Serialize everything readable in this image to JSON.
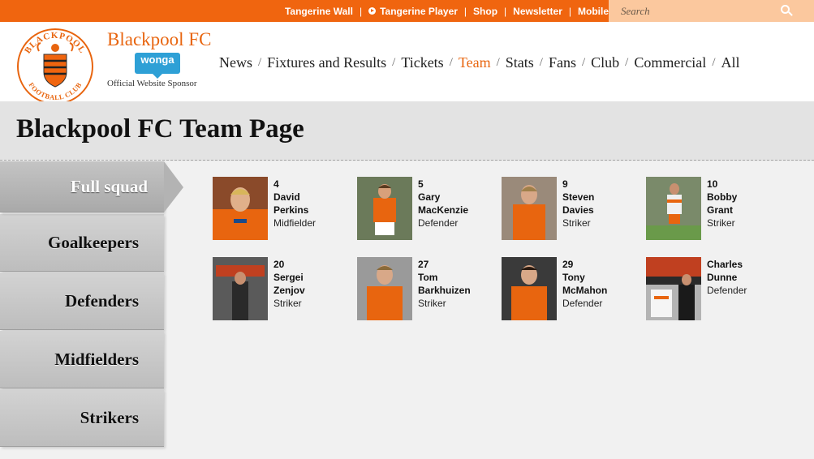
{
  "topbar": {
    "links": [
      "Tangerine Wall",
      "Tangerine Player",
      "Shop",
      "Newsletter",
      "Mobile"
    ],
    "search_placeholder": "Search"
  },
  "header": {
    "club_name": "Blackpool FC",
    "sponsor_logo_text": "wonga",
    "sponsor_text": "Official Website Sponsor",
    "crest_text_top": "BLACKPOOL",
    "crest_text_bottom": "FOOTBALL CLUB",
    "nav": [
      "News",
      "Fixtures and Results",
      "Tickets",
      "Team",
      "Stats",
      "Fans",
      "Club",
      "Commercial",
      "All"
    ],
    "active_nav": "Team"
  },
  "page": {
    "title": "Blackpool FC Team Page"
  },
  "menu": [
    "Full squad",
    "Goalkeepers",
    "Defenders",
    "Midfielders",
    "Strikers"
  ],
  "players": [
    {
      "number": "4",
      "first": "David",
      "last": "Perkins",
      "position": "Midfielder"
    },
    {
      "number": "5",
      "first": "Gary",
      "last": "MacKenzie",
      "position": "Defender"
    },
    {
      "number": "9",
      "first": "Steven",
      "last": "Davies",
      "position": "Striker"
    },
    {
      "number": "10",
      "first": "Bobby",
      "last": "Grant",
      "position": "Striker"
    },
    {
      "number": "20",
      "first": "Sergei",
      "last": "Zenjov",
      "position": "Striker"
    },
    {
      "number": "27",
      "first": "Tom",
      "last": "Barkhuizen",
      "position": "Striker"
    },
    {
      "number": "29",
      "first": "Tony",
      "last": "McMahon",
      "position": "Defender"
    },
    {
      "number": "",
      "first": "Charles",
      "last": "Dunne",
      "position": "Defender"
    }
  ],
  "colors": {
    "brand": "#f0650f",
    "accent": "#e8650f",
    "sponsor": "#2ea0d6"
  }
}
